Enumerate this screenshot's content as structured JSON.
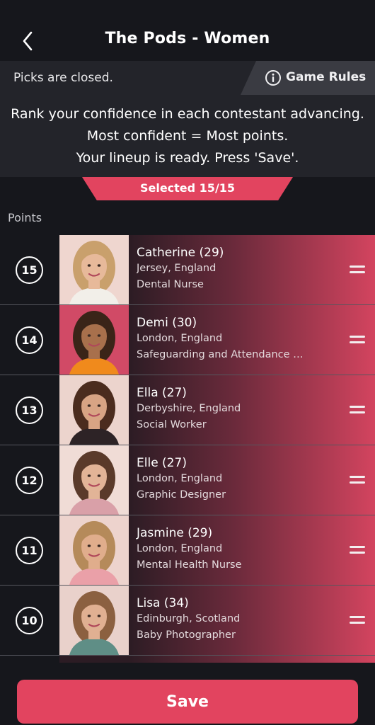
{
  "header": {
    "title": "The Pods - Women"
  },
  "status": {
    "text": "Picks are closed.",
    "rules_label": "Game Rules"
  },
  "instructions": [
    "Rank your confidence in each contestant advancing.",
    "Most confident = Most points.",
    "Your lineup is ready. Press 'Save'."
  ],
  "selected": {
    "label": "Selected 15/15"
  },
  "list": {
    "points_label": "Points",
    "contestants": [
      {
        "points": "15",
        "name": "Catherine (29)",
        "location": "Jersey, England",
        "job": "Dental Nurse",
        "hair": "#c9a06c",
        "skin": "#e7b99a",
        "top": "#f2efe9",
        "bg": "#efd6cf"
      },
      {
        "points": "14",
        "name": "Demi (30)",
        "location": "London, England",
        "job": "Safeguarding and Attendance Officer",
        "hair": "#3a2418",
        "skin": "#a8704c",
        "top": "#f08a1c",
        "bg": "#d14a66"
      },
      {
        "points": "13",
        "name": "Ella (27)",
        "location": "Derbyshire, England",
        "job": "Social Worker",
        "hair": "#4b2c1e",
        "skin": "#d8a484",
        "top": "#2d2326",
        "bg": "#ecd4cd"
      },
      {
        "points": "12",
        "name": "Elle (27)",
        "location": "London, England",
        "job": "Graphic Designer",
        "hair": "#5a3a2a",
        "skin": "#e2b497",
        "top": "#d9a0a8",
        "bg": "#f0dcd6"
      },
      {
        "points": "11",
        "name": "Jasmine (29)",
        "location": "London, England",
        "job": "Mental Health Nurse",
        "hair": "#b58a5a",
        "skin": "#e0ad8c",
        "top": "#eaa0a8",
        "bg": "#edd3cd"
      },
      {
        "points": "10",
        "name": "Lisa (34)",
        "location": "Edinburgh, Scotland",
        "job": "Baby Photographer",
        "hair": "#8b6040",
        "skin": "#e0b092",
        "top": "#5f8e86",
        "bg": "#e9d1cb"
      }
    ]
  },
  "footer": {
    "save_label": "Save"
  }
}
